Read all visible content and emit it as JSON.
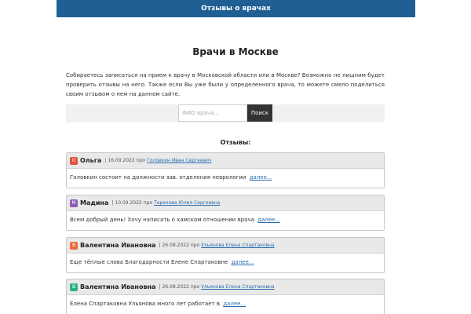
{
  "header": {
    "title": "Отзывы о врачах"
  },
  "main": {
    "title": "Врачи в Москве",
    "intro": "Собираетесь записаться на прием к врачу в Московской области или в Москве? Возможно не лишним будет проверить отзывы на него. Также если Вы уже были у определенного врача, то можете смело поделиться своим отзывом о нем на данном сайте."
  },
  "search": {
    "placeholder": "ФИО врача...",
    "button_label": "Поиск"
  },
  "reviews_heading": "Отзывы:",
  "reviews": [
    {
      "initial": "О",
      "avatar_color": "#e0533b",
      "author": "Ольга",
      "date": "16.09.2022",
      "about": "про",
      "doctor": "Головкин Иван Сергеевич",
      "text": "Головкин состоит на должности зав. отделения неврологии",
      "more": "далее..."
    },
    {
      "initial": "М",
      "avatar_color": "#8e5bb5",
      "author": "Мадина",
      "date": "10.09.2022",
      "about": "про",
      "doctor": "Терехова Юлия Сергеевна",
      "text": "Всем добрый день! Хочу написать о хамском отношении врача",
      "more": "далее..."
    },
    {
      "initial": "В",
      "avatar_color": "#ec6a3b",
      "author": "Валентина Ивановна",
      "date": "26.08.2022",
      "about": "про",
      "doctor": "Ульянова Елена Спартаковна",
      "text": "Еще тёплые слова Благодарности Елене Спартаковне",
      "more": "далее..."
    },
    {
      "initial": "В",
      "avatar_color": "#2fb08a",
      "author": "Валентина Ивановна",
      "date": "26.08.2022",
      "about": "про",
      "doctor": "Ульянова Елена Спартаковна",
      "text": "Елена Спартаковна Ульянова много лет работает в",
      "more": "далее..."
    }
  ]
}
